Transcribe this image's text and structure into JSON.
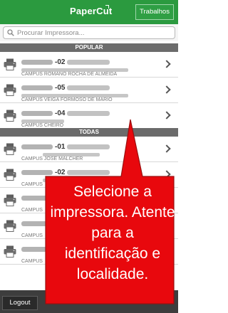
{
  "header": {
    "brand": "PaperCut",
    "jobs_button": "Trabalhos"
  },
  "search": {
    "placeholder": "Procurar Impressora..."
  },
  "sections": {
    "popular": "POPULAR",
    "all": "TODAS"
  },
  "popular_printers": [
    {
      "code": "-02",
      "location": "CAMPUS ROMANO ROCHA DE ALMEIDA"
    },
    {
      "code": "-05",
      "location": "CAMPUS VEIGA FORMOSO DE MARIO"
    },
    {
      "code": "-04",
      "location": "CAMPUS CHEIRO"
    }
  ],
  "all_printers": [
    {
      "code": "-01",
      "location": "CAMPUS JOSE MALCHER"
    },
    {
      "code": "-02",
      "location": "CAMPUS"
    },
    {
      "code": "",
      "location": "CAMPUS"
    },
    {
      "code": "",
      "location": "CAMPUS"
    },
    {
      "code": "",
      "location": "CAMPUS"
    }
  ],
  "footer": {
    "logout": "Logout"
  },
  "callout": {
    "text": "Selecione a impressora. Atente para a identificação e localidade."
  },
  "colors": {
    "brand_green": "#2b9a3f",
    "section_gray": "#6b6b6b",
    "callout_red": "#e8080d",
    "footer_dark": "#3d3d3d"
  }
}
